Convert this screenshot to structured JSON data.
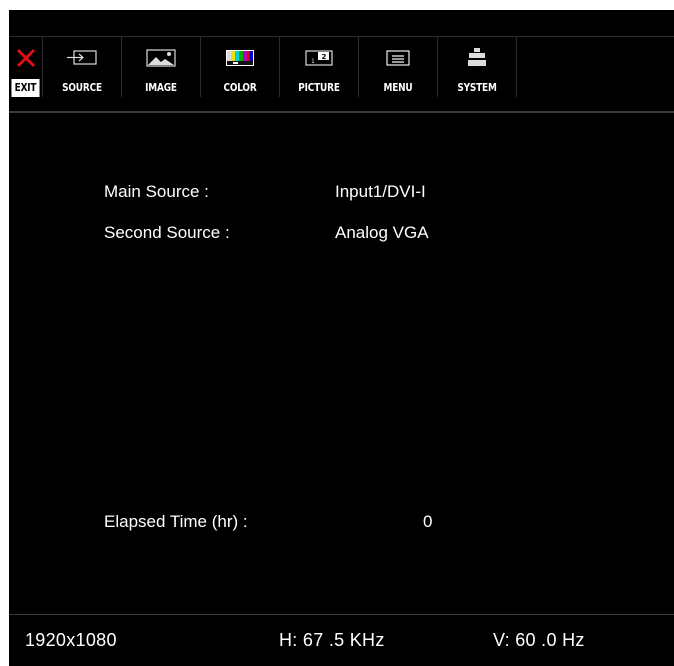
{
  "toolbar": {
    "items": [
      {
        "label": "EXIT",
        "icon": "close-icon"
      },
      {
        "label": "SOURCE",
        "icon": "input-icon"
      },
      {
        "label": "IMAGE",
        "icon": "image-icon"
      },
      {
        "label": "COLOR",
        "icon": "color-bars-icon"
      },
      {
        "label": "PICTURE",
        "icon": "picture-in-picture-icon"
      },
      {
        "label": "MENU",
        "icon": "menu-icon"
      },
      {
        "label": "SYSTEM",
        "icon": "system-icon"
      }
    ]
  },
  "info": {
    "main_source_label": "Main Source :",
    "main_source_value": "Input1/DVI-I",
    "second_source_label": "Second Source :",
    "second_source_value": "Analog VGA",
    "elapsed_label": "Elapsed Time (hr) :",
    "elapsed_value": "0"
  },
  "status": {
    "resolution": "1920x1080",
    "h_freq": "H:  67 .5 KHz",
    "v_freq": "V:  60 .0 Hz"
  },
  "colors": {
    "background": "#000000",
    "exit_icon": "#e01010",
    "text": "#ffffff"
  }
}
